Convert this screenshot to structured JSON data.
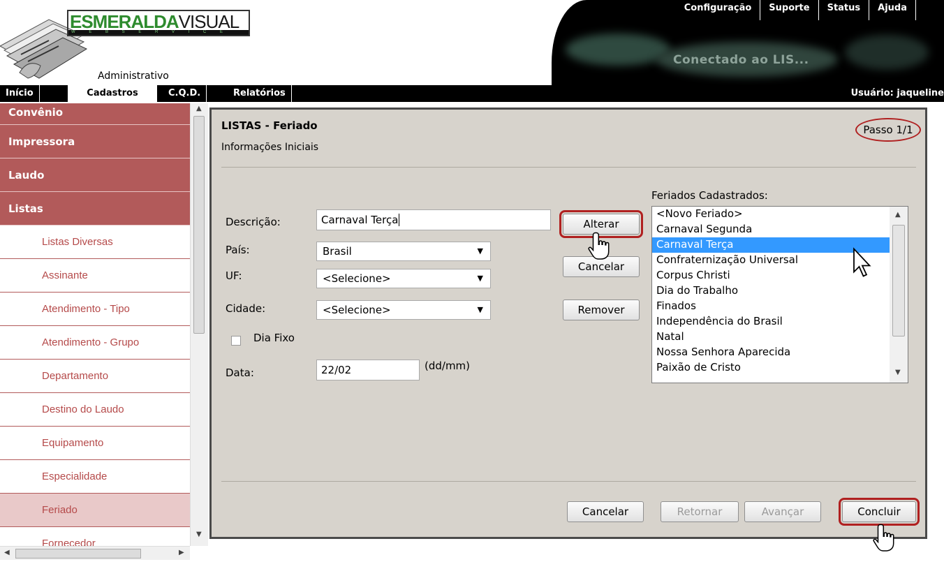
{
  "app": {
    "brand_bold": "ESMERALDA",
    "brand_light": "VISUAL",
    "brand_tagline": "W E B   S E R V I C E",
    "area_label": "Administrativo",
    "connection_status": "Conectado ao LIS..."
  },
  "top_links": [
    "Configuração",
    "Suporte",
    "Status",
    "Ajuda"
  ],
  "nav": {
    "tabs": [
      "Início",
      "Cadastros",
      "C.Q.D.",
      "Relatórios"
    ],
    "active": "Cadastros",
    "user_label": "Usuário: jaqueline"
  },
  "sidebar": {
    "categories": [
      "Convênio",
      "Impressora",
      "Laudo",
      "Listas"
    ],
    "subitems": [
      "Listas Diversas",
      "Assinante",
      "Atendimento - Tipo",
      "Atendimento - Grupo",
      "Departamento",
      "Destino do Laudo",
      "Equipamento",
      "Especialidade",
      "Feriado",
      "Fornecedor"
    ],
    "active_subitem": "Feriado"
  },
  "panel": {
    "title": "LISTAS - Feriado",
    "subtitle": "Informações Iniciais",
    "step": "Passo 1/1"
  },
  "form": {
    "descricao_label": "Descrição:",
    "descricao_value": "Carnaval Terça",
    "pais_label": "País:",
    "pais_value": "Brasil",
    "uf_label": "UF:",
    "uf_value": "<Selecione>",
    "cidade_label": "Cidade:",
    "cidade_value": "<Selecione>",
    "dia_fixo_label": "Dia Fixo",
    "dia_fixo_checked": false,
    "data_label": "Data:",
    "data_value": "22/02",
    "data_hint": "(dd/mm)"
  },
  "actions": {
    "alterar": "Alterar",
    "cancelar": "Cancelar",
    "remover": "Remover"
  },
  "holidays": {
    "label": "Feriados Cadastrados:",
    "items": [
      "<Novo Feriado>",
      "Carnaval Segunda",
      "Carnaval Terça",
      "Confraternização Universal",
      "Corpus Christi",
      "Dia do Trabalho",
      "Finados",
      "Independência do Brasil",
      "Natal",
      "Nossa Senhora Aparecida",
      "Paixão de Cristo"
    ],
    "selected": "Carnaval Terça"
  },
  "footer": {
    "cancelar": "Cancelar",
    "retornar": "Retornar",
    "avancar": "Avançar",
    "concluir": "Concluir"
  },
  "colors": {
    "sidebar_category_bg": "#b25a5a",
    "sidebar_sub_text": "#b54a4a",
    "panel_bg": "#d7d3cc",
    "selection_bg": "#3399ff",
    "highlight_ring": "#b02020"
  }
}
